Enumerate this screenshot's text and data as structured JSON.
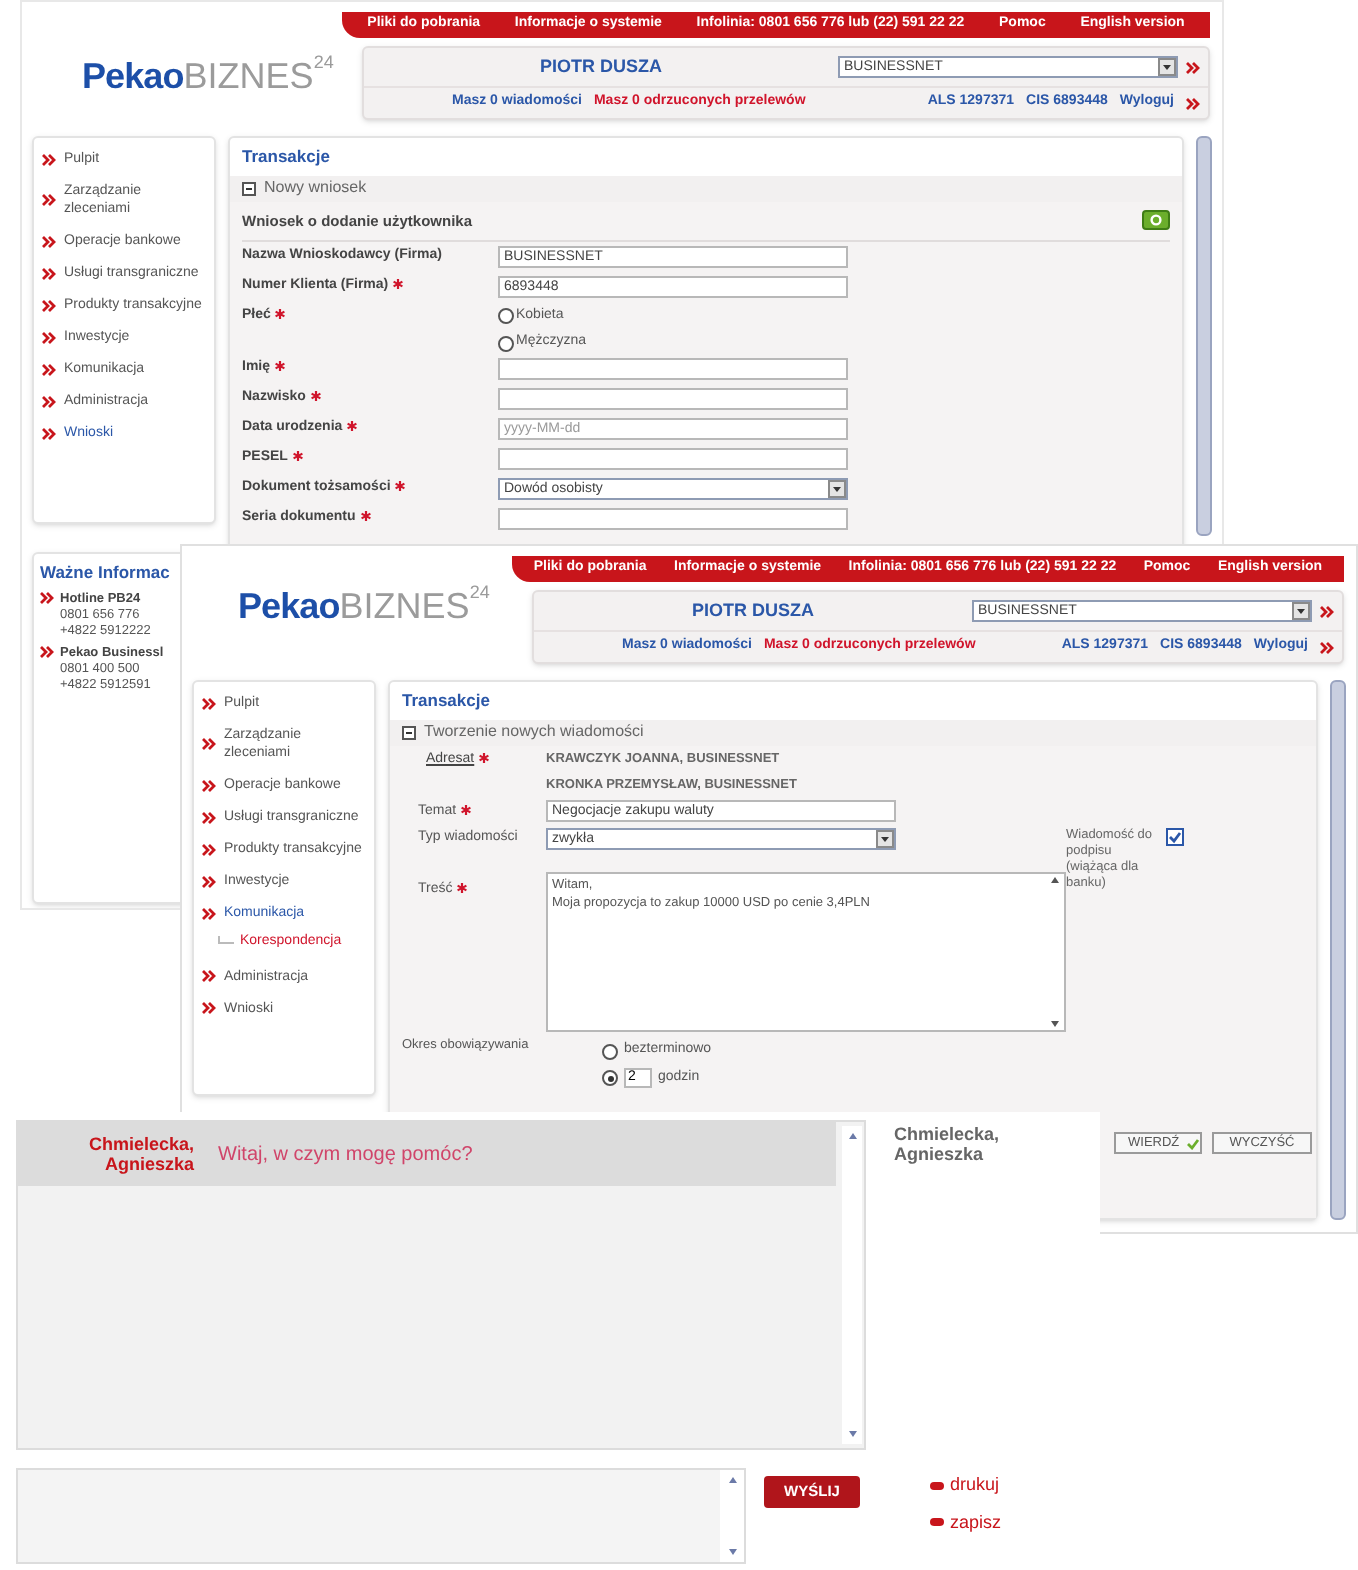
{
  "window_1": {
    "top_links": [
      "Pliki do pobrania",
      "Informacje o systemie",
      "Infolinia: 0801 656 776 lub (22) 591 22 22",
      "Pomoc",
      "English version"
    ],
    "logo": {
      "brand": "Pekao",
      "product": "BIZNES",
      "superscript": "24"
    },
    "user_name": "PIOTR DUSZA",
    "account_select": "BUSINESSNET",
    "messages_link": "Masz 0 wiadomości",
    "rejected_link": "Masz 0 odrzuconych przelewów",
    "als": "ALS 1297371",
    "cis": "CIS 6893448",
    "logout": "Wyloguj",
    "sidebar": [
      {
        "label": "Pulpit",
        "selected": false
      },
      {
        "label": "Zarządzanie zleceniami",
        "selected": false
      },
      {
        "label": "Operacje bankowe",
        "selected": false
      },
      {
        "label": "Usługi transgraniczne",
        "selected": false
      },
      {
        "label": "Produkty transakcyjne",
        "selected": false
      },
      {
        "label": "Inwestycje",
        "selected": false
      },
      {
        "label": "Komunikacja",
        "selected": false
      },
      {
        "label": "Administracja",
        "selected": false
      },
      {
        "label": "Wnioski",
        "selected": true
      }
    ],
    "info_box": {
      "title": "Ważne Informac",
      "items": [
        {
          "title": "Hotline PB24",
          "lines": [
            "0801 656 776",
            "+4822 5912222"
          ]
        },
        {
          "title": "Pekao Businessl",
          "lines": [
            "0801 400 500",
            "+4822 5912591"
          ]
        }
      ]
    },
    "section_title": "Transakcje",
    "panel_title": "Nowy wniosek",
    "form_title": "Wniosek o dodanie użytkownika",
    "fields": [
      {
        "kind": "text",
        "label": "Nazwa Wnioskodawcy (Firma)",
        "required": false,
        "value": "BUSINESSNET"
      },
      {
        "kind": "text",
        "label": "Numer Klienta (Firma)",
        "required": true,
        "value": "6893448"
      },
      {
        "kind": "radio",
        "label": "Płeć",
        "required": true,
        "options": [
          {
            "label": "Kobieta",
            "selected": false
          },
          {
            "label": "Mężczyzna",
            "selected": false
          }
        ]
      },
      {
        "kind": "text",
        "label": "Imię",
        "required": true
      },
      {
        "kind": "text",
        "label": "Nazwisko",
        "required": true
      },
      {
        "kind": "text",
        "label": "Data urodzenia",
        "required": true,
        "placeholder": "yyyy-MM-dd"
      },
      {
        "kind": "text",
        "label": "PESEL",
        "required": true
      },
      {
        "kind": "select",
        "label": "Dokument tożsamości",
        "required": true,
        "value": "Dowód osobisty"
      },
      {
        "kind": "text",
        "label": "Seria dokumentu",
        "required": true
      }
    ]
  },
  "window_2": {
    "top_links": [
      "Pliki do pobrania",
      "Informacje o systemie",
      "Infolinia: 0801 656 776 lub (22) 591 22 22",
      "Pomoc",
      "English version"
    ],
    "logo": {
      "brand": "Pekao",
      "product": "BIZNES",
      "superscript": "24"
    },
    "user_name": "PIOTR DUSZA",
    "account_select": "BUSINESSNET",
    "messages_link": "Masz 0 wiadomości",
    "rejected_link": "Masz 0 odrzuconych przelewów",
    "als": "ALS 1297371",
    "cis": "CIS 6893448",
    "logout": "Wyloguj",
    "sidebar": [
      {
        "label": "Pulpit",
        "selected": false
      },
      {
        "label": "Zarządzanie zleceniami",
        "selected": false
      },
      {
        "label": "Operacje bankowe",
        "selected": false
      },
      {
        "label": "Usługi transgraniczne",
        "selected": false
      },
      {
        "label": "Produkty transakcyjne",
        "selected": false
      },
      {
        "label": "Inwestycje",
        "selected": false
      },
      {
        "label": "Komunikacja",
        "selected": true,
        "children": [
          {
            "label": "Korespondencja",
            "selected": true
          }
        ]
      },
      {
        "label": "Administracja",
        "selected": false
      },
      {
        "label": "Wnioski",
        "selected": false
      }
    ],
    "section_title": "Transakcje",
    "panel_title": "Tworzenie nowych wiadomości",
    "recipient": {
      "label": "Adresat",
      "required": true,
      "values": [
        "KRAWCZYK JOANNA, BUSINESSNET",
        "KRONKA PRZEMYSŁAW, BUSINESSNET"
      ]
    },
    "subject": {
      "label": "Temat",
      "required": true,
      "value": "Negocjacje zakupu waluty"
    },
    "message_type": {
      "label": "Typ wiadomości",
      "required": false,
      "value": "zwykła"
    },
    "signature": {
      "label": "Wiadomość do podpisu (wiążąca dla banku)",
      "checked": true
    },
    "body": {
      "label": "Treść",
      "required": true,
      "value": "Witam,\nMoja propozycja to zakup 10000 USD po cenie 3,4PLN"
    },
    "validity": {
      "label": "Okres obowiązywania",
      "options": [
        {
          "kind": "plain",
          "label": "bezterminowo",
          "selected": false
        },
        {
          "kind": "amount",
          "value": "2",
          "label": "godzin",
          "selected": true
        }
      ]
    },
    "buttons": [
      {
        "kind": "confirm",
        "label": "WIERDŹ"
      },
      {
        "kind": "plain",
        "label": "WYCZYŚĆ"
      }
    ]
  },
  "chat": {
    "messages": [
      {
        "sender": "Chmielecka, Agnieszka",
        "text": "Witaj, w czym mogę pomóc?"
      }
    ],
    "participant": "Chmielecka, Agnieszka",
    "send_button": "WYŚLIJ",
    "links": [
      "drukuj",
      "zapisz"
    ]
  }
}
